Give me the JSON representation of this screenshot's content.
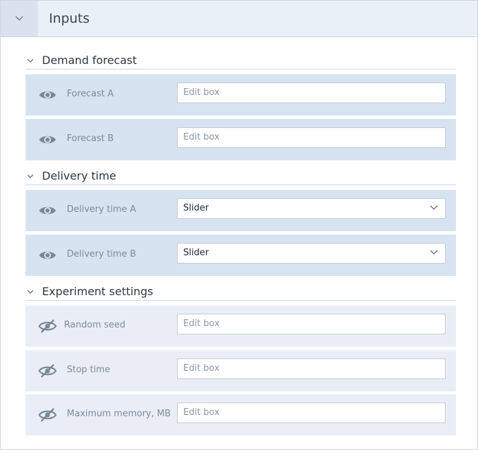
{
  "header": {
    "title": "Inputs",
    "collapse_icon": "chevron-down-icon"
  },
  "sections": [
    {
      "title": "Demand forecast",
      "rows": [
        {
          "label": "Forecast A",
          "control": "Edit box",
          "visible": true
        },
        {
          "label": "Forecast B",
          "control": "Edit box",
          "visible": true
        }
      ]
    },
    {
      "title": "Delivery time",
      "rows": [
        {
          "label": "Delivery time A",
          "control": "Slider",
          "visible": true
        },
        {
          "label": "Delivery time B",
          "control": "Slider",
          "visible": true
        }
      ]
    },
    {
      "title": "Experiment settings",
      "rows": [
        {
          "label": "Random seed",
          "control": "Edit box",
          "visible": false
        },
        {
          "label": "Stop time",
          "control": "Edit box",
          "visible": false
        },
        {
          "label": "Maximum memory, MB",
          "control": "Edit box",
          "visible": false
        }
      ]
    }
  ],
  "icons": {
    "visible": "eye-icon",
    "hidden": "eye-off-icon",
    "dropdown": "chevron-down-icon"
  },
  "colors": {
    "row_visible_bg": "#d7e3f0",
    "row_hidden_bg": "#e9eef6",
    "header_bg": "#eaf0f8",
    "icon": "#7a8796"
  }
}
